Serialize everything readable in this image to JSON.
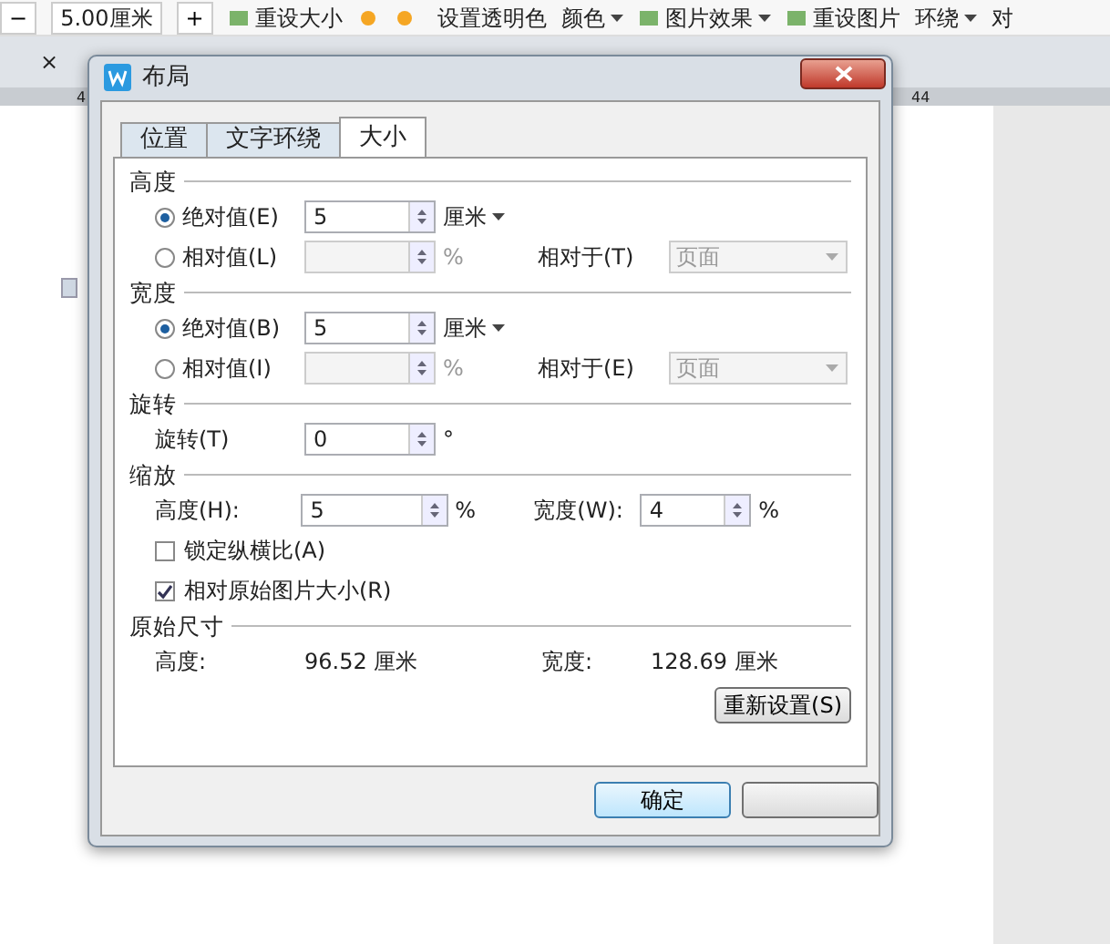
{
  "toolbar": {
    "decrement": "−",
    "size_value": "5.00厘米",
    "increment": "+",
    "reset_size": "重设大小",
    "transparent_color": "设置透明色",
    "color_menu": "颜色",
    "picture_effects": "图片效果",
    "reset_picture": "重设图片",
    "wrap": "环绕",
    "align": "对"
  },
  "doc_tabs": {
    "close": "×"
  },
  "ruler": {
    "labels": [
      "4",
      "44"
    ]
  },
  "dialog": {
    "title": "布局",
    "tabs": [
      {
        "label": "位置",
        "selected": false
      },
      {
        "label": "文字环绕",
        "selected": false
      },
      {
        "label": "大小",
        "selected": true
      }
    ],
    "sections": [
      {
        "title": "高度",
        "rows": [
          {
            "kind": "radio",
            "label": "绝对值(E)",
            "selected": true,
            "disabled": false,
            "value": "5",
            "unit": "厘米"
          },
          {
            "kind": "radio",
            "label": "相对值(L)",
            "selected": false,
            "disabled": true,
            "unit": "%",
            "relative_label": "相对于(T)",
            "relative_value": "页面"
          }
        ]
      },
      {
        "title": "宽度",
        "rows": [
          {
            "kind": "radio",
            "label": "绝对值(B)",
            "selected": true,
            "disabled": false,
            "value": "5",
            "unit": "厘米"
          },
          {
            "kind": "radio",
            "label": "相对值(I)",
            "selected": false,
            "disabled": true,
            "unit": "%",
            "relative_label": "相对于(E)",
            "relative_value": "页面"
          }
        ]
      },
      {
        "title": "旋转",
        "rows": [
          {
            "kind": "spin",
            "label": "旋转(T)",
            "value": "0",
            "unit": "°"
          }
        ]
      },
      {
        "title": "缩放",
        "rows": [
          {
            "kind": "pair",
            "fields": [
              {
                "label": "高度(H):",
                "value": "5",
                "unit": "%"
              },
              {
                "label": "宽度(W):",
                "value": "4",
                "unit": "%"
              }
            ]
          },
          {
            "kind": "checkbox",
            "label": "锁定纵横比(A)",
            "checked": false
          },
          {
            "kind": "checkbox",
            "label": "相对原始图片大小(R)",
            "checked": true
          }
        ]
      },
      {
        "title": "原始尺寸",
        "rows": [
          {
            "kind": "info",
            "items": [
              {
                "label": "高度:",
                "value": "96.52 厘米"
              },
              {
                "label": "宽度:",
                "value": "128.69 厘米"
              }
            ]
          },
          {
            "kind": "button",
            "label": "重新设置(S)"
          }
        ]
      }
    ],
    "buttons": [
      "确定"
    ]
  }
}
